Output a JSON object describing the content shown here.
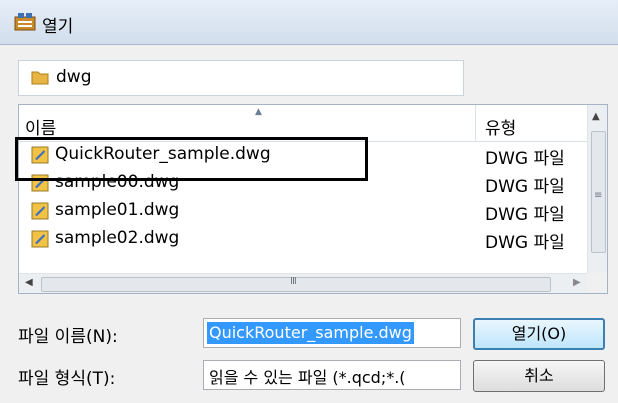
{
  "window": {
    "title": "열기",
    "icon": "app-icon"
  },
  "path": {
    "folder_icon": "folder-icon",
    "current": "dwg"
  },
  "file_list": {
    "columns": {
      "name": "이름",
      "type": "유형"
    },
    "rows": [
      {
        "name": "QuickRouter_sample.dwg",
        "type": "DWG 파일",
        "icon": "dwg-file-icon"
      },
      {
        "name": "sample00.dwg",
        "type": "DWG 파일",
        "icon": "dwg-file-icon"
      },
      {
        "name": "sample01.dwg",
        "type": "DWG 파일",
        "icon": "dwg-file-icon"
      },
      {
        "name": "sample02.dwg",
        "type": "DWG 파일",
        "icon": "dwg-file-icon"
      }
    ]
  },
  "form": {
    "filename_label": "파일 이름(N):",
    "filename_value": "QuickRouter_sample.dwg",
    "filetype_label": "파일 형식(T):",
    "filetype_value": "읽을 수 있는 파일 (*.qcd;*.("
  },
  "buttons": {
    "open": "열기(O)",
    "cancel": "취소"
  },
  "colors": {
    "selection": "#3399ff",
    "highlight_border": "#000000"
  }
}
